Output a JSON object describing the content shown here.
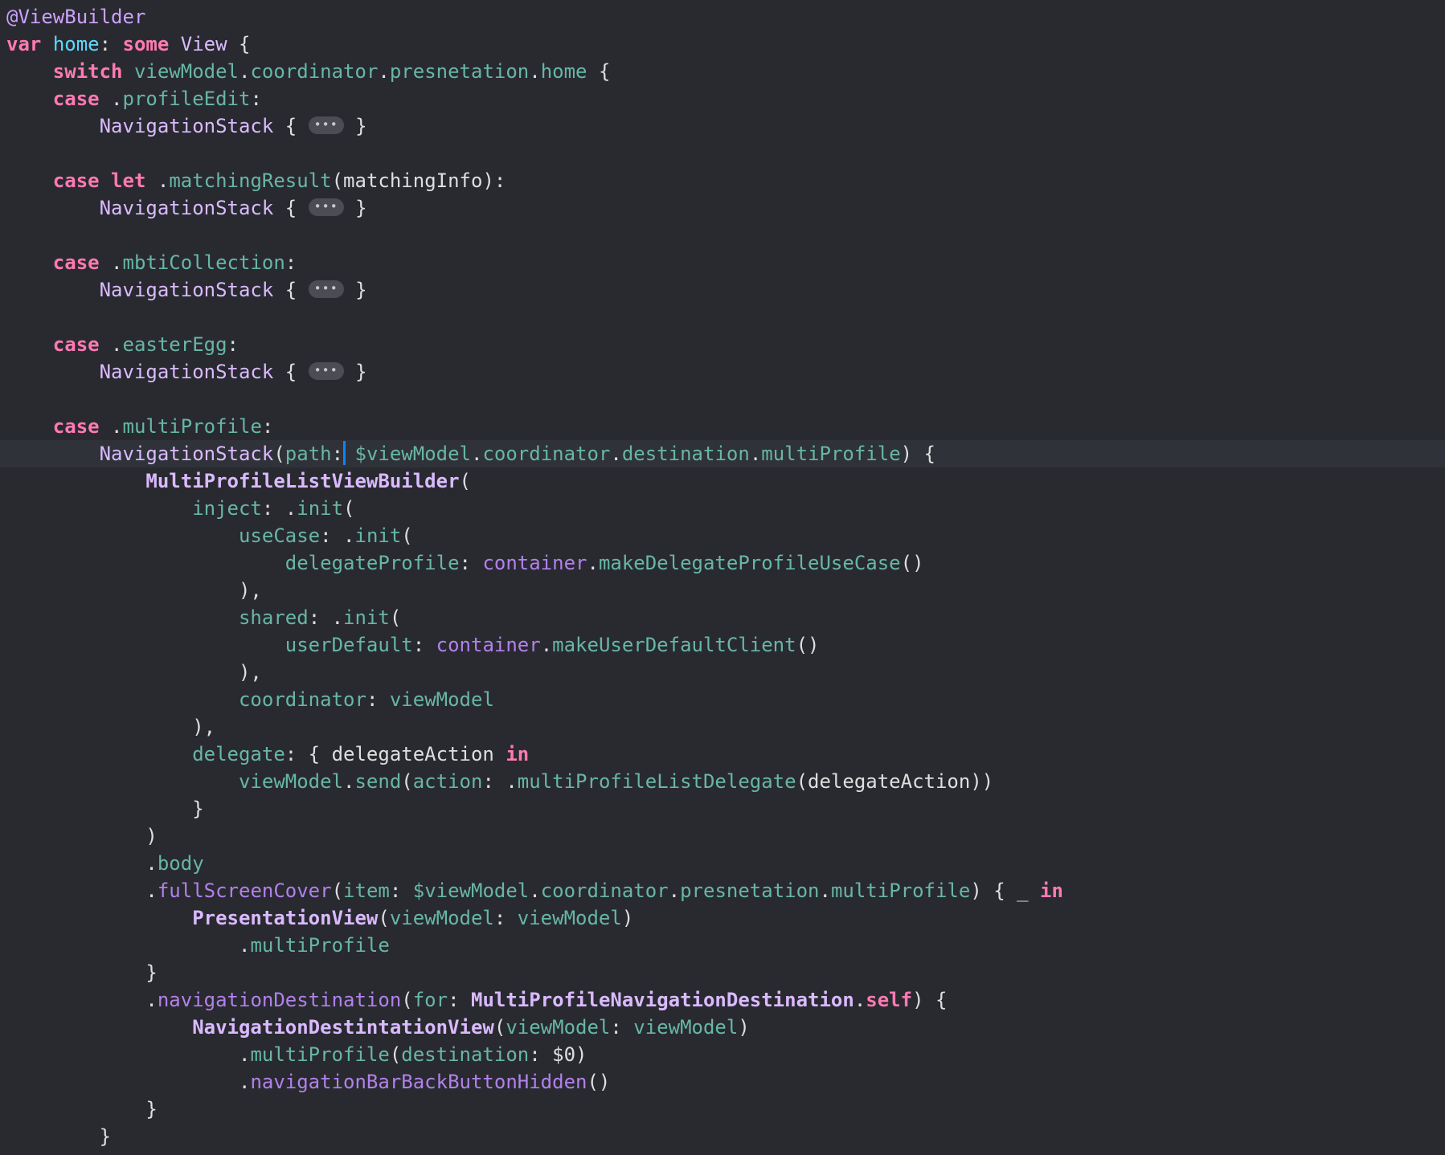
{
  "editor": {
    "fold_placeholder": "•••",
    "lines": [
      [
        [
          "attr",
          "@ViewBuilder"
        ]
      ],
      [
        [
          "kw",
          "var"
        ],
        [
          "pln",
          " "
        ],
        [
          "decl",
          "home"
        ],
        [
          "pln",
          ": "
        ],
        [
          "kw",
          "some"
        ],
        [
          "pln",
          " "
        ],
        [
          "type",
          "View"
        ],
        [
          "pln",
          " {"
        ]
      ],
      [
        [
          "pln",
          "    "
        ],
        [
          "kw",
          "switch"
        ],
        [
          "pln",
          " "
        ],
        [
          "ident",
          "viewModel"
        ],
        [
          "pln",
          "."
        ],
        [
          "ident",
          "coordinator"
        ],
        [
          "pln",
          "."
        ],
        [
          "ident",
          "presnetation"
        ],
        [
          "pln",
          "."
        ],
        [
          "ident",
          "home"
        ],
        [
          "pln",
          " {"
        ]
      ],
      [
        [
          "pln",
          "    "
        ],
        [
          "kw",
          "case"
        ],
        [
          "pln",
          " ."
        ],
        [
          "ident",
          "profileEdit"
        ],
        [
          "pln",
          ":"
        ]
      ],
      [
        [
          "pln",
          "        "
        ],
        [
          "type",
          "NavigationStack"
        ],
        [
          "pln",
          " { "
        ],
        [
          "fold",
          ""
        ],
        [
          "pln",
          " }"
        ]
      ],
      [],
      [
        [
          "pln",
          "    "
        ],
        [
          "kw",
          "case"
        ],
        [
          "pln",
          " "
        ],
        [
          "kw",
          "let"
        ],
        [
          "pln",
          " ."
        ],
        [
          "ident",
          "matchingResult"
        ],
        [
          "pln",
          "(matchingInfo):"
        ]
      ],
      [
        [
          "pln",
          "        "
        ],
        [
          "type",
          "NavigationStack"
        ],
        [
          "pln",
          " { "
        ],
        [
          "fold",
          ""
        ],
        [
          "pln",
          " }"
        ]
      ],
      [],
      [
        [
          "pln",
          "    "
        ],
        [
          "kw",
          "case"
        ],
        [
          "pln",
          " ."
        ],
        [
          "ident",
          "mbtiCollection"
        ],
        [
          "pln",
          ":"
        ]
      ],
      [
        [
          "pln",
          "        "
        ],
        [
          "type",
          "NavigationStack"
        ],
        [
          "pln",
          " { "
        ],
        [
          "fold",
          ""
        ],
        [
          "pln",
          " }"
        ]
      ],
      [],
      [
        [
          "pln",
          "    "
        ],
        [
          "kw",
          "case"
        ],
        [
          "pln",
          " ."
        ],
        [
          "ident",
          "easterEgg"
        ],
        [
          "pln",
          ":"
        ]
      ],
      [
        [
          "pln",
          "        "
        ],
        [
          "type",
          "NavigationStack"
        ],
        [
          "pln",
          " { "
        ],
        [
          "fold",
          ""
        ],
        [
          "pln",
          " }"
        ]
      ],
      [],
      [
        [
          "pln",
          "    "
        ],
        [
          "kw",
          "case"
        ],
        [
          "pln",
          " ."
        ],
        [
          "ident",
          "multiProfile"
        ],
        [
          "pln",
          ":"
        ]
      ],
      [
        [
          "pln",
          "        "
        ],
        [
          "type",
          "NavigationStack"
        ],
        [
          "pln",
          "("
        ],
        [
          "ident",
          "path"
        ],
        [
          "pln",
          ":"
        ],
        [
          "caret",
          ""
        ],
        [
          "pln",
          " "
        ],
        [
          "ident",
          "$viewModel"
        ],
        [
          "pln",
          "."
        ],
        [
          "ident",
          "coordinator"
        ],
        [
          "pln",
          "."
        ],
        [
          "ident",
          "destination"
        ],
        [
          "pln",
          "."
        ],
        [
          "ident",
          "multiProfile"
        ],
        [
          "pln",
          ") {"
        ]
      ],
      [
        [
          "pln",
          "            "
        ],
        [
          "ptype",
          "MultiProfileListViewBuilder"
        ],
        [
          "pln",
          "("
        ]
      ],
      [
        [
          "pln",
          "                "
        ],
        [
          "ident",
          "inject"
        ],
        [
          "pln",
          ": ."
        ],
        [
          "ident",
          "init"
        ],
        [
          "pln",
          "("
        ]
      ],
      [
        [
          "pln",
          "                    "
        ],
        [
          "ident",
          "useCase"
        ],
        [
          "pln",
          ": ."
        ],
        [
          "ident",
          "init"
        ],
        [
          "pln",
          "("
        ]
      ],
      [
        [
          "pln",
          "                        "
        ],
        [
          "ident",
          "delegateProfile"
        ],
        [
          "pln",
          ": "
        ],
        [
          "proj",
          "container"
        ],
        [
          "pln",
          "."
        ],
        [
          "ident",
          "makeDelegateProfileUseCase"
        ],
        [
          "pln",
          "()"
        ]
      ],
      [
        [
          "pln",
          "                    ),"
        ]
      ],
      [
        [
          "pln",
          "                    "
        ],
        [
          "ident",
          "shared"
        ],
        [
          "pln",
          ": ."
        ],
        [
          "ident",
          "init"
        ],
        [
          "pln",
          "("
        ]
      ],
      [
        [
          "pln",
          "                        "
        ],
        [
          "ident",
          "userDefault"
        ],
        [
          "pln",
          ": "
        ],
        [
          "proj",
          "container"
        ],
        [
          "pln",
          "."
        ],
        [
          "ident",
          "makeUserDefaultClient"
        ],
        [
          "pln",
          "()"
        ]
      ],
      [
        [
          "pln",
          "                    ),"
        ]
      ],
      [
        [
          "pln",
          "                    "
        ],
        [
          "ident",
          "coordinator"
        ],
        [
          "pln",
          ": "
        ],
        [
          "ident",
          "viewModel"
        ]
      ],
      [
        [
          "pln",
          "                ),"
        ]
      ],
      [
        [
          "pln",
          "                "
        ],
        [
          "ident",
          "delegate"
        ],
        [
          "pln",
          ": { delegateAction "
        ],
        [
          "kw",
          "in"
        ]
      ],
      [
        [
          "pln",
          "                    "
        ],
        [
          "ident",
          "viewModel"
        ],
        [
          "pln",
          "."
        ],
        [
          "ident",
          "send"
        ],
        [
          "pln",
          "("
        ],
        [
          "ident",
          "action"
        ],
        [
          "pln",
          ": ."
        ],
        [
          "ident",
          "multiProfileListDelegate"
        ],
        [
          "pln",
          "(delegateAction))"
        ]
      ],
      [
        [
          "pln",
          "                }"
        ]
      ],
      [
        [
          "pln",
          "            )"
        ]
      ],
      [
        [
          "pln",
          "            ."
        ],
        [
          "ident",
          "body"
        ]
      ],
      [
        [
          "pln",
          "            ."
        ],
        [
          "proj",
          "fullScreenCover"
        ],
        [
          "pln",
          "("
        ],
        [
          "ident",
          "item"
        ],
        [
          "pln",
          ": "
        ],
        [
          "ident",
          "$viewModel"
        ],
        [
          "pln",
          "."
        ],
        [
          "ident",
          "coordinator"
        ],
        [
          "pln",
          "."
        ],
        [
          "ident",
          "presnetation"
        ],
        [
          "pln",
          "."
        ],
        [
          "ident",
          "multiProfile"
        ],
        [
          "pln",
          ") { _ "
        ],
        [
          "kw",
          "in"
        ]
      ],
      [
        [
          "pln",
          "                "
        ],
        [
          "ptype",
          "PresentationView"
        ],
        [
          "pln",
          "("
        ],
        [
          "ident",
          "viewModel"
        ],
        [
          "pln",
          ": "
        ],
        [
          "ident",
          "viewModel"
        ],
        [
          "pln",
          ")"
        ]
      ],
      [
        [
          "pln",
          "                    ."
        ],
        [
          "ident",
          "multiProfile"
        ]
      ],
      [
        [
          "pln",
          "            }"
        ]
      ],
      [
        [
          "pln",
          "            ."
        ],
        [
          "proj",
          "navigationDestination"
        ],
        [
          "pln",
          "("
        ],
        [
          "ident",
          "for"
        ],
        [
          "pln",
          ": "
        ],
        [
          "ptype",
          "MultiProfileNavigationDestination"
        ],
        [
          "pln",
          "."
        ],
        [
          "kw",
          "self"
        ],
        [
          "pln",
          ") {"
        ]
      ],
      [
        [
          "pln",
          "                "
        ],
        [
          "ptype",
          "NavigationDestintationView"
        ],
        [
          "pln",
          "("
        ],
        [
          "ident",
          "viewModel"
        ],
        [
          "pln",
          ": "
        ],
        [
          "ident",
          "viewModel"
        ],
        [
          "pln",
          ")"
        ]
      ],
      [
        [
          "pln",
          "                    ."
        ],
        [
          "ident",
          "multiProfile"
        ],
        [
          "pln",
          "("
        ],
        [
          "ident",
          "destination"
        ],
        [
          "pln",
          ": $0)"
        ]
      ],
      [
        [
          "pln",
          "                    ."
        ],
        [
          "proj",
          "navigationBarBackButtonHidden"
        ],
        [
          "pln",
          "()"
        ]
      ],
      [
        [
          "pln",
          "            }"
        ]
      ],
      [
        [
          "pln",
          "        }"
        ]
      ]
    ]
  }
}
